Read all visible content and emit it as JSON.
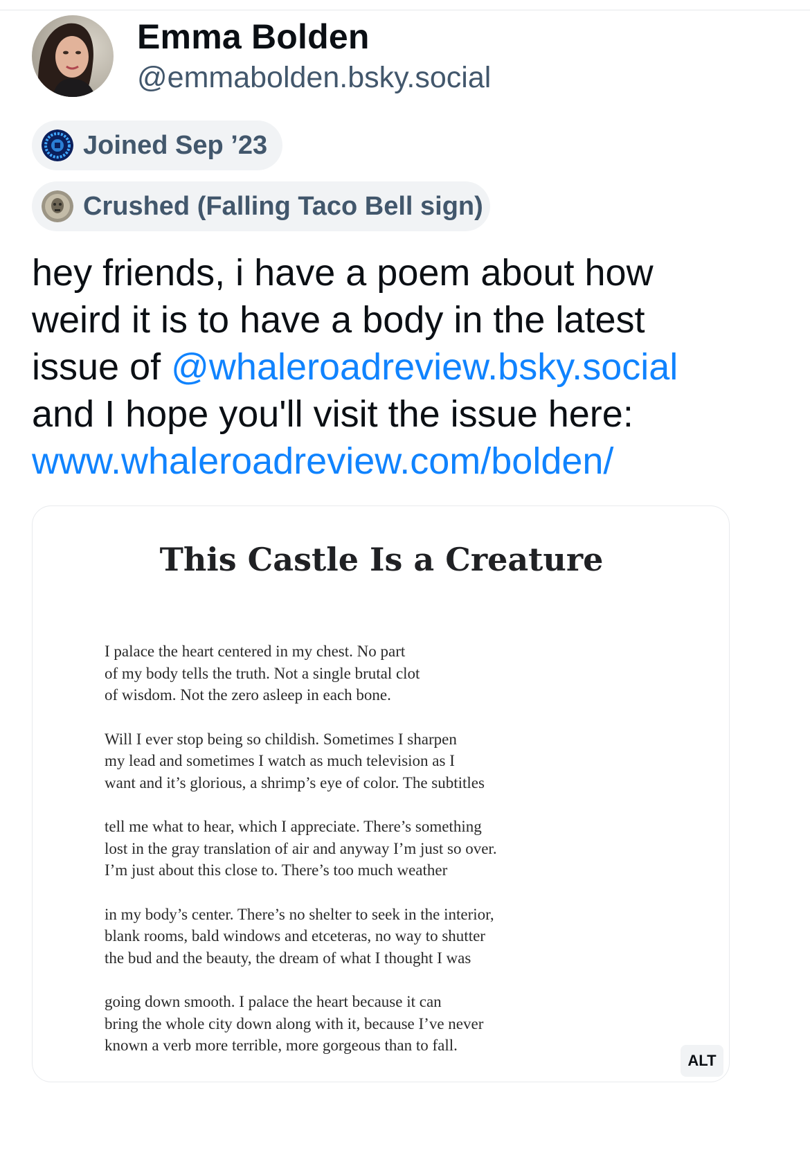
{
  "author": {
    "display_name": "Emma Bolden",
    "handle": "@emmabolden.bsky.social",
    "avatar_icon": "profile-photo"
  },
  "pills": {
    "joined": {
      "icon": "globe-badge-icon",
      "label": "Joined Sep ’23"
    },
    "badge": {
      "icon": "coin-medallion-icon",
      "label": "Crushed (Falling Taco Bell sign)"
    }
  },
  "post": {
    "lines": {
      "l1": "hey friends, i have a poem about how",
      "l2": "weird it is to have a body in the latest",
      "l3_prefix": "issue of ",
      "mention": "@whaleroadreview.bsky.social",
      "l4": "and I hope you'll visit the issue here:",
      "url": "www.whaleroadreview.com/bolden/"
    },
    "link_color": "#1083fe"
  },
  "embed": {
    "title": "This Castle Is a Creature",
    "stanzas": [
      [
        "I palace the heart centered in my chest. No part",
        "of my body tells the truth. Not a single brutal clot",
        "of wisdom. Not the zero asleep in each bone."
      ],
      [
        "Will I ever stop being so childish. Sometimes I sharpen",
        "my lead and sometimes I watch as much television as I",
        "want and it’s glorious, a shrimp’s eye of color. The subtitles"
      ],
      [
        "tell me what to hear, which I appreciate. There’s something",
        "lost in the gray translation of air and anyway I’m just so over.",
        "I’m just about this close to. There’s too much weather"
      ],
      [
        "in my body’s center. There’s no shelter to seek in the interior,",
        "blank rooms, bald windows and etceteras, no way to shutter",
        "the bud and the beauty, the dream of what I thought I was"
      ],
      [
        "going down smooth. I palace the heart because it can",
        "bring the whole city down along with it, because I’ve never",
        "known a verb more terrible, more gorgeous than to fall."
      ]
    ],
    "alt_label": "ALT"
  }
}
